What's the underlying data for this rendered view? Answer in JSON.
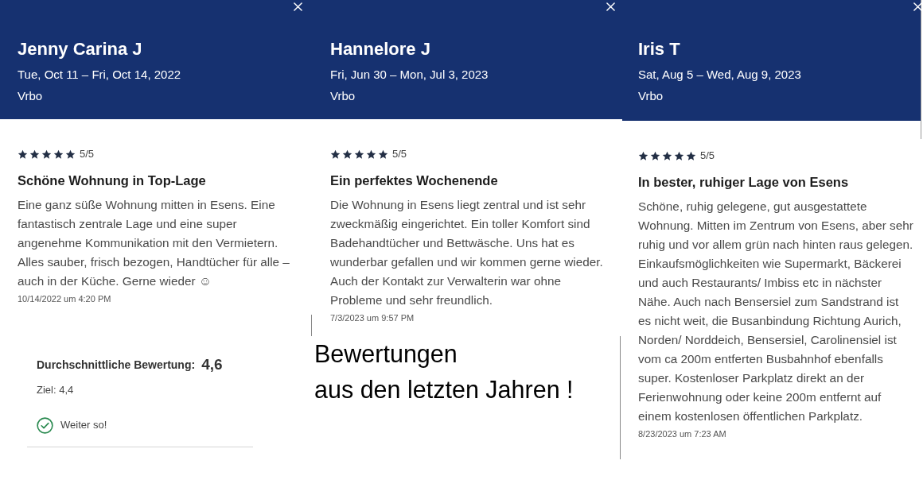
{
  "reviews": [
    {
      "reviewer": "Jenny Carina J",
      "dates": "Tue, Oct 11 – Fri, Oct 14, 2022",
      "source": "Vrbo",
      "stars": 5,
      "rating": "5/5",
      "title": "Schöne Wohnung in Top-Lage",
      "text": "Eine ganz süße Wohnung mitten in Esens. Eine fantastisch zentrale Lage und eine super angenehme Kommunikation mit den Vermietern. Alles sauber, frisch bezogen, Handtücher für alle – auch in der Küche. Gerne wieder ☺",
      "timestamp": "10/14/2022 um 4:20 PM"
    },
    {
      "reviewer": "Hannelore J",
      "dates": "Fri, Jun 30 – Mon, Jul 3, 2023",
      "source": "Vrbo",
      "stars": 5,
      "rating": "5/5",
      "title": "Ein perfektes Wochenende",
      "text": "Die Wohnung in Esens liegt zentral und ist sehr zweckmäßig eingerichtet. Ein toller Komfort sind Badehandtücher und Bettwäsche. Uns hat es wunderbar gefallen und wir kommen gerne wieder. Auch der Kontakt zur Verwalterin war ohne Probleme und sehr freundlich.",
      "timestamp": "7/3/2023 um 9:57 PM"
    },
    {
      "reviewer": "Iris T",
      "dates": "Sat, Aug 5 – Wed, Aug 9, 2023",
      "source": "Vrbo",
      "stars": 5,
      "rating": "5/5",
      "title": "In bester, ruhiger Lage von Esens",
      "text": "Schöne, ruhig gelegene, gut ausgestattete Wohnung. Mitten im Zentrum von Esens, aber sehr ruhig und vor allem grün nach hinten raus gelegen. Einkaufsmöglichkeiten wie Supermarkt, Bäckerei und auch Restaurants/ Imbiss etc in nächster Nähe. Auch nach Bensersiel zum Sandstrand ist es nicht weit, die Busanbindung Richtung Aurich, Norden/ Norddeich, Bensersiel, Carolinensiel ist vom ca 200m entferten Busbahnhof ebenfalls super. Kostenloser Parkplatz direkt an der Ferienwohnung oder keine 200m entfernt auf einem kostenlosen öffentlichen Parkplatz.",
      "timestamp": "8/23/2023 um 7:23 AM"
    }
  ],
  "summary": {
    "label": "Durchschnittliche Bewertung:",
    "value": "4,6",
    "target": "Ziel: 4,4",
    "status": "Weiter so!"
  },
  "annotation": "Bewertungen\naus den letzten Jahren !"
}
